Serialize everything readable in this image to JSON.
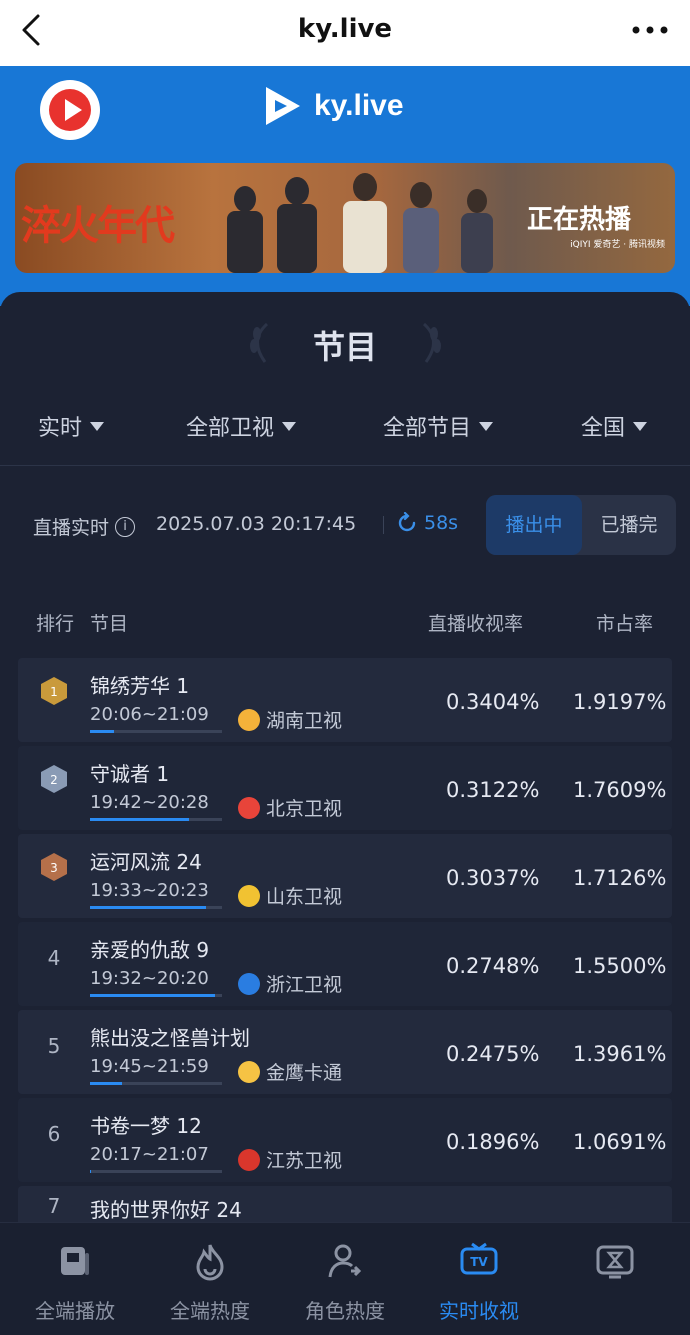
{
  "browser": {
    "title": "ky.live"
  },
  "header": {
    "brand": "ky.live"
  },
  "banner": {
    "title": "淬火年代",
    "tagline": "正在热播",
    "sponsors": "iQIYI 爱奇艺 · 腾讯视频"
  },
  "section": {
    "title": "节目"
  },
  "filters": [
    {
      "label": "实时"
    },
    {
      "label": "全部卫视"
    },
    {
      "label": "全部节目"
    },
    {
      "label": "全国"
    }
  ],
  "live": {
    "label": "直播实时",
    "datetime": "2025.07.03 20:17:45",
    "countdown": "58s",
    "toggle_on": "播出中",
    "toggle_off": "已播完"
  },
  "table": {
    "headers": {
      "rank": "排行",
      "program": "节目",
      "rating": "直播收视率",
      "share": "市占率"
    },
    "rows": [
      {
        "rank": "1",
        "name": "锦绣芳华 1",
        "time": "20:06~21:09",
        "channel": "湖南卫视",
        "rating": "0.3404%",
        "share": "1.9197%",
        "progress": 0.18,
        "badge": "gold",
        "logo_color": "#f4b23a"
      },
      {
        "rank": "2",
        "name": "守诚者 1",
        "time": "19:42~20:28",
        "channel": "北京卫视",
        "rating": "0.3122%",
        "share": "1.7609%",
        "progress": 0.75,
        "badge": "silver",
        "logo_color": "#e8443a"
      },
      {
        "rank": "3",
        "name": "运河风流 24",
        "time": "19:33~20:23",
        "channel": "山东卫视",
        "rating": "0.3037%",
        "share": "1.7126%",
        "progress": 0.88,
        "badge": "bronze",
        "logo_color": "#f1c232"
      },
      {
        "rank": "4",
        "name": "亲爱的仇敌 9",
        "time": "19:32~20:20",
        "channel": "浙江卫视",
        "rating": "0.2748%",
        "share": "1.5500%",
        "progress": 0.95,
        "badge": "",
        "logo_color": "#2a7de1"
      },
      {
        "rank": "5",
        "name": "熊出没之怪兽计划",
        "time": "19:45~21:59",
        "channel": "金鹰卡通",
        "rating": "0.2475%",
        "share": "1.3961%",
        "progress": 0.24,
        "badge": "",
        "logo_color": "#f6c344"
      },
      {
        "rank": "6",
        "name": "书卷一梦 12",
        "time": "20:17~21:07",
        "channel": "江苏卫视",
        "rating": "0.1896%",
        "share": "1.0691%",
        "progress": 0.01,
        "badge": "",
        "logo_color": "#d9362c"
      },
      {
        "rank": "7",
        "name": "我的世界你好 24",
        "time": "",
        "channel": "",
        "rating": "",
        "share": "",
        "progress": 0,
        "badge": "",
        "logo_color": "#888888"
      }
    ]
  },
  "bottom_nav": [
    {
      "label": "全端播放",
      "icon": "play-board-icon"
    },
    {
      "label": "全端热度",
      "icon": "flame-icon"
    },
    {
      "label": "角色热度",
      "icon": "person-icon"
    },
    {
      "label": "实时收视",
      "icon": "tv-icon",
      "active": true
    },
    {
      "label": "",
      "icon": "hourglass-tv-icon"
    }
  ],
  "colors": {
    "accent": "#2a8bf2",
    "header_blue": "#1877d6",
    "card_bg": "#1c2233"
  }
}
